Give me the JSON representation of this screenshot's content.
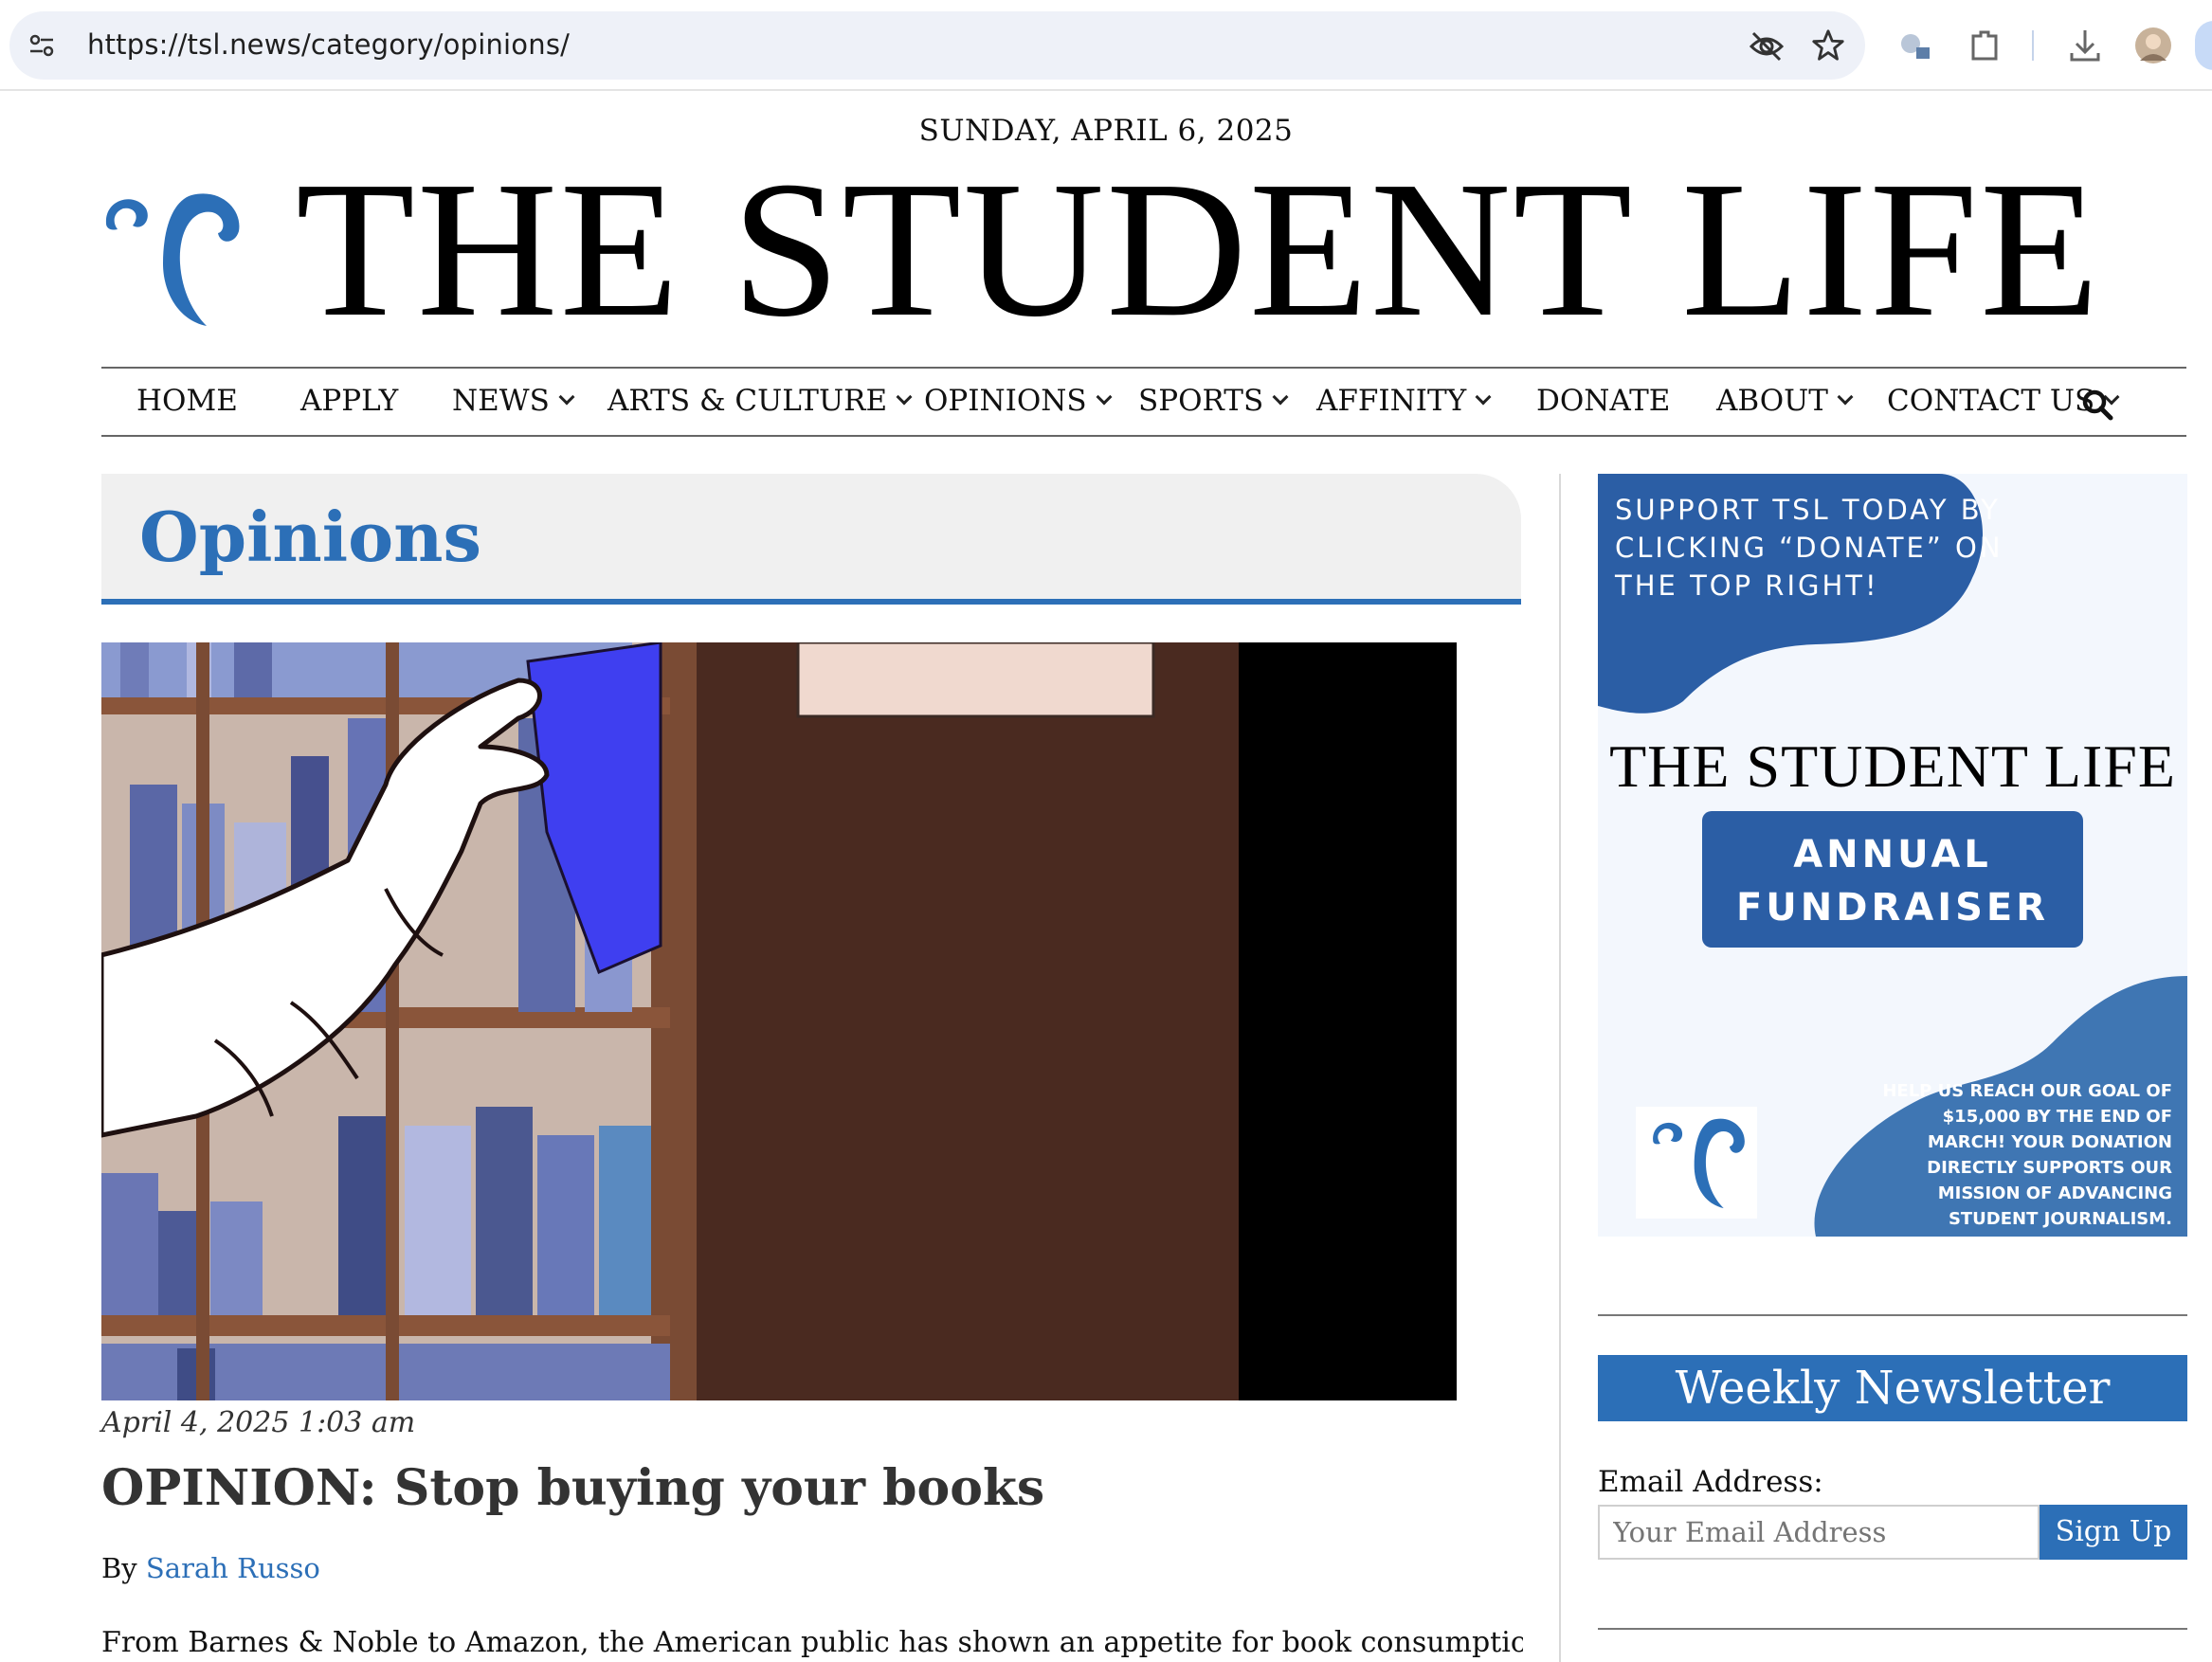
{
  "browser": {
    "url": "https://tsl.news/category/opinions/"
  },
  "header": {
    "date": "SUNDAY, APRIL 6, 2025",
    "site_title": "THE STUDENT LIFE"
  },
  "nav": {
    "items": [
      {
        "label": "HOME",
        "has_dropdown": false
      },
      {
        "label": "APPLY",
        "has_dropdown": false
      },
      {
        "label": "NEWS",
        "has_dropdown": true
      },
      {
        "label": "ARTS & CULTURE",
        "has_dropdown": true
      },
      {
        "label": "OPINIONS",
        "has_dropdown": true
      },
      {
        "label": "SPORTS",
        "has_dropdown": true
      },
      {
        "label": "AFFINITY",
        "has_dropdown": true
      },
      {
        "label": "DONATE",
        "has_dropdown": false
      },
      {
        "label": "ABOUT",
        "has_dropdown": true
      },
      {
        "label": "CONTACT US",
        "has_dropdown": true
      }
    ]
  },
  "category": {
    "title": "Opinions"
  },
  "article": {
    "date": "April 4, 2025 1:03 am",
    "title": "OPINION: Stop buying your books",
    "by_prefix": "By",
    "author": "Sarah Russo",
    "excerpt": "From Barnes & Noble to Amazon, the American public has shown an appetite for book consumption. In"
  },
  "sidebar": {
    "ad": {
      "support_text": "SUPPORT TSL TODAY BY CLICKING “DONATE” ON THE TOP RIGHT!",
      "brand": "THE STUDENT LIFE",
      "button_line1": "ANNUAL",
      "button_line2": "FUNDRAISER",
      "goal_text": "HELP US REACH OUR GOAL OF $15,000 BY THE END OF MARCH! YOUR DONATION DIRECTLY SUPPORTS OUR MISSION OF ADVANCING STUDENT JOURNALISM."
    },
    "newsletter": {
      "heading": "Weekly Newsletter",
      "email_label": "Email Address:",
      "email_placeholder": "Your Email Address",
      "submit_label": "Sign Up"
    }
  },
  "colors": {
    "brand_blue": "#2c6fb7",
    "ad_blue": "#2b5ea5"
  }
}
